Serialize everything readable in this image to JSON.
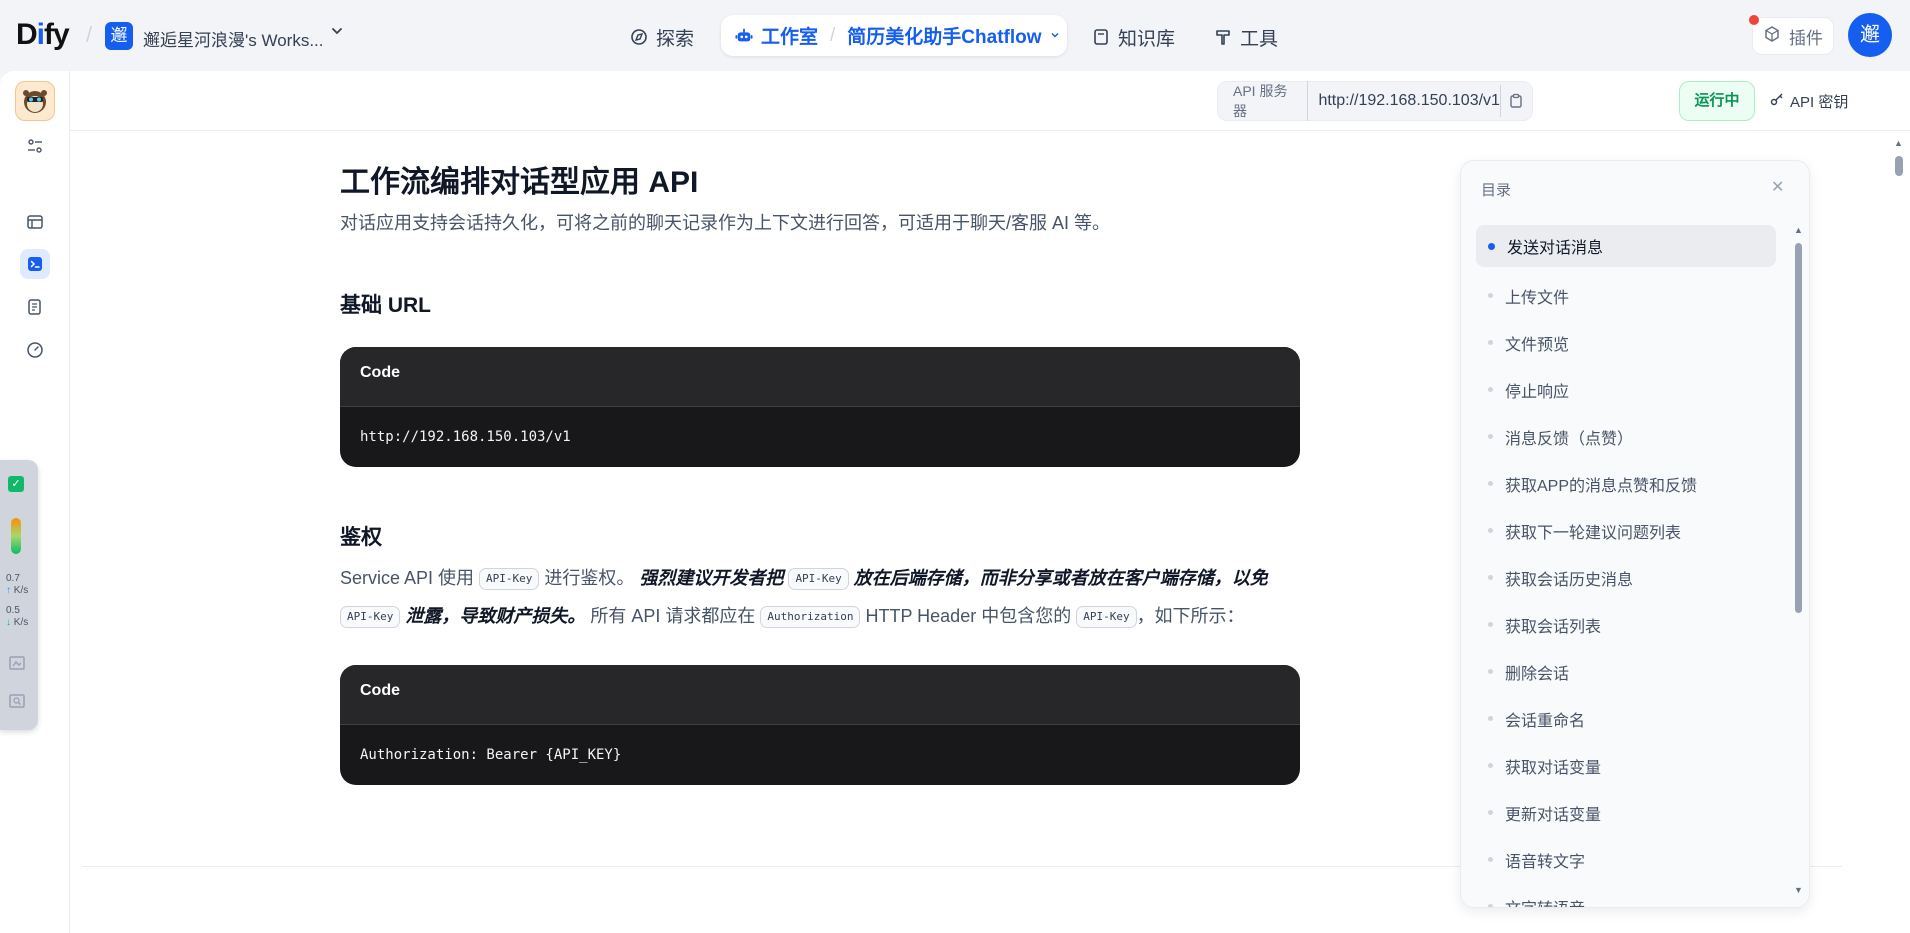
{
  "topbar": {
    "logo": "Dify",
    "workspace": {
      "avatar": "邂",
      "name": "邂逅星河浪漫's Works..."
    },
    "nav": {
      "explore": "探索",
      "studio": "工作室",
      "app_name": "简历美化助手Chatflow",
      "knowledge": "知识库",
      "tools": "工具"
    },
    "plugins": "插件",
    "user_avatar": "邂"
  },
  "header": {
    "api_server_label": "API 服务器",
    "api_server_url": "http://192.168.150.103/v1",
    "status": "运行中",
    "api_key_label": "API 密钥"
  },
  "widget": {
    "upload_value": "0.7",
    "upload_unit": "K/s",
    "download_value": "0.5",
    "download_unit": "K/s"
  },
  "doc": {
    "title": "工作流编排对话型应用 API",
    "lead": "对话应用支持会话持久化，可将之前的聊天记录作为上下文进行回答，可适用于聊天/客服 AI 等。",
    "base_url_heading": "基础 URL",
    "code1": {
      "header": "Code",
      "body": "http://192.168.150.103/v1"
    },
    "auth_heading": "鉴权",
    "auth": {
      "p1": "Service API 使用 ",
      "k1": "API-Key",
      "p2": " 进行鉴权。 ",
      "b1": "强烈建议开发者把 ",
      "k2": "API-Key",
      "b2": " 放在后端存储，而非分享或者放在客户端存储，以免 ",
      "k3": "API-Key",
      "b3": " 泄露，导致财产损失。",
      "p3": " 所有 API 请求都应在 ",
      "k4": "Authorization",
      "p4": " HTTP Header 中包含您的 ",
      "k5": "API-Key",
      "p5": "，如下所示："
    },
    "code2": {
      "header": "Code",
      "body": "Authorization: Bearer {API_KEY}"
    }
  },
  "toc": {
    "title": "目录",
    "items": [
      "发送对话消息",
      "上传文件",
      "文件预览",
      "停止响应",
      "消息反馈（点赞）",
      "获取APP的消息点赞和反馈",
      "获取下一轮建议问题列表",
      "获取会话历史消息",
      "获取会话列表",
      "删除会话",
      "会话重命名",
      "获取对话变量",
      "更新对话变量",
      "语音转文字",
      "文字转语音"
    ]
  },
  "colors": {
    "accent": "#155eef",
    "running": "#079455",
    "code_bg": "#18181b"
  }
}
